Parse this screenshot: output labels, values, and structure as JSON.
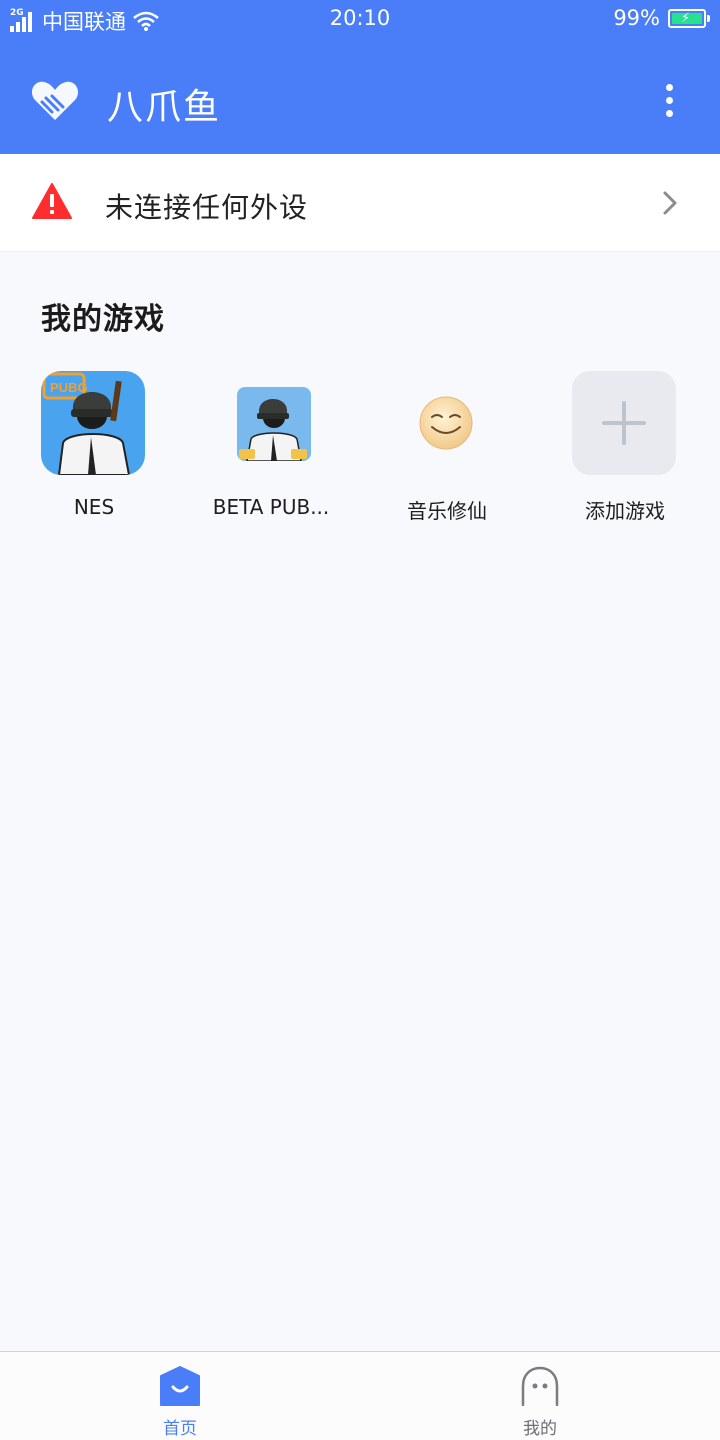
{
  "status_bar": {
    "network": "2G",
    "carrier": "中国联通",
    "time": "20:10",
    "battery": "99%"
  },
  "header": {
    "app_title": "八爪鱼",
    "logo_icon": "heart-handshake-icon",
    "menu_icon": "more-vertical-icon"
  },
  "alert": {
    "text": "未连接任何外设",
    "icon": "warning-triangle-icon",
    "color": "#ff2d2d"
  },
  "games_section": {
    "title": "我的游戏",
    "items": [
      {
        "label": "NES",
        "icon": "pubg-game-icon"
      },
      {
        "label": "BETA PUB...",
        "icon": "pubg-beta-game-icon"
      },
      {
        "label": "音乐修仙",
        "icon": "smiley-game-icon"
      },
      {
        "label": "添加游戏",
        "icon": "plus-icon"
      }
    ]
  },
  "tab_bar": {
    "tabs": [
      {
        "label": "首页",
        "icon": "home-icon",
        "active": true
      },
      {
        "label": "我的",
        "icon": "ghost-profile-icon",
        "active": false
      }
    ]
  },
  "colors": {
    "primary": "#4a7df8",
    "background": "#f8f9fc",
    "warning": "#ff2d2d"
  }
}
